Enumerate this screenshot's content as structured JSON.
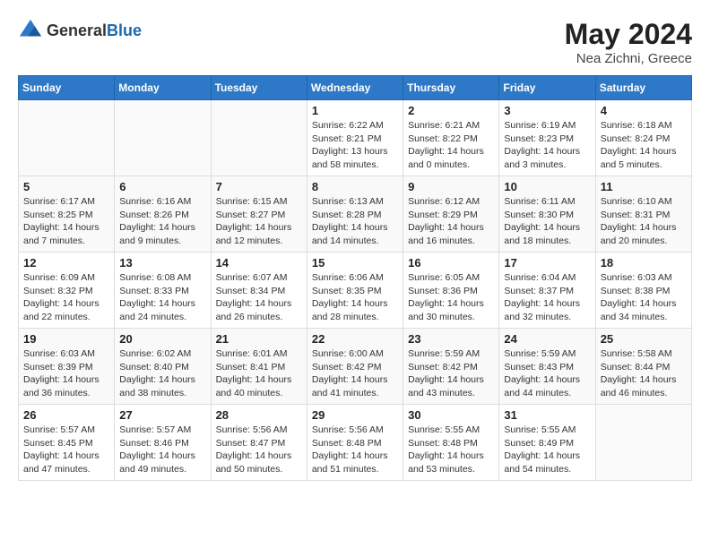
{
  "header": {
    "logo_general": "General",
    "logo_blue": "Blue",
    "month_year": "May 2024",
    "location": "Nea Zichni, Greece"
  },
  "weekdays": [
    "Sunday",
    "Monday",
    "Tuesday",
    "Wednesday",
    "Thursday",
    "Friday",
    "Saturday"
  ],
  "weeks": [
    [
      {
        "day": "",
        "sunrise": "",
        "sunset": "",
        "daylight": ""
      },
      {
        "day": "",
        "sunrise": "",
        "sunset": "",
        "daylight": ""
      },
      {
        "day": "",
        "sunrise": "",
        "sunset": "",
        "daylight": ""
      },
      {
        "day": "1",
        "sunrise": "Sunrise: 6:22 AM",
        "sunset": "Sunset: 8:21 PM",
        "daylight": "Daylight: 13 hours and 58 minutes."
      },
      {
        "day": "2",
        "sunrise": "Sunrise: 6:21 AM",
        "sunset": "Sunset: 8:22 PM",
        "daylight": "Daylight: 14 hours and 0 minutes."
      },
      {
        "day": "3",
        "sunrise": "Sunrise: 6:19 AM",
        "sunset": "Sunset: 8:23 PM",
        "daylight": "Daylight: 14 hours and 3 minutes."
      },
      {
        "day": "4",
        "sunrise": "Sunrise: 6:18 AM",
        "sunset": "Sunset: 8:24 PM",
        "daylight": "Daylight: 14 hours and 5 minutes."
      }
    ],
    [
      {
        "day": "5",
        "sunrise": "Sunrise: 6:17 AM",
        "sunset": "Sunset: 8:25 PM",
        "daylight": "Daylight: 14 hours and 7 minutes."
      },
      {
        "day": "6",
        "sunrise": "Sunrise: 6:16 AM",
        "sunset": "Sunset: 8:26 PM",
        "daylight": "Daylight: 14 hours and 9 minutes."
      },
      {
        "day": "7",
        "sunrise": "Sunrise: 6:15 AM",
        "sunset": "Sunset: 8:27 PM",
        "daylight": "Daylight: 14 hours and 12 minutes."
      },
      {
        "day": "8",
        "sunrise": "Sunrise: 6:13 AM",
        "sunset": "Sunset: 8:28 PM",
        "daylight": "Daylight: 14 hours and 14 minutes."
      },
      {
        "day": "9",
        "sunrise": "Sunrise: 6:12 AM",
        "sunset": "Sunset: 8:29 PM",
        "daylight": "Daylight: 14 hours and 16 minutes."
      },
      {
        "day": "10",
        "sunrise": "Sunrise: 6:11 AM",
        "sunset": "Sunset: 8:30 PM",
        "daylight": "Daylight: 14 hours and 18 minutes."
      },
      {
        "day": "11",
        "sunrise": "Sunrise: 6:10 AM",
        "sunset": "Sunset: 8:31 PM",
        "daylight": "Daylight: 14 hours and 20 minutes."
      }
    ],
    [
      {
        "day": "12",
        "sunrise": "Sunrise: 6:09 AM",
        "sunset": "Sunset: 8:32 PM",
        "daylight": "Daylight: 14 hours and 22 minutes."
      },
      {
        "day": "13",
        "sunrise": "Sunrise: 6:08 AM",
        "sunset": "Sunset: 8:33 PM",
        "daylight": "Daylight: 14 hours and 24 minutes."
      },
      {
        "day": "14",
        "sunrise": "Sunrise: 6:07 AM",
        "sunset": "Sunset: 8:34 PM",
        "daylight": "Daylight: 14 hours and 26 minutes."
      },
      {
        "day": "15",
        "sunrise": "Sunrise: 6:06 AM",
        "sunset": "Sunset: 8:35 PM",
        "daylight": "Daylight: 14 hours and 28 minutes."
      },
      {
        "day": "16",
        "sunrise": "Sunrise: 6:05 AM",
        "sunset": "Sunset: 8:36 PM",
        "daylight": "Daylight: 14 hours and 30 minutes."
      },
      {
        "day": "17",
        "sunrise": "Sunrise: 6:04 AM",
        "sunset": "Sunset: 8:37 PM",
        "daylight": "Daylight: 14 hours and 32 minutes."
      },
      {
        "day": "18",
        "sunrise": "Sunrise: 6:03 AM",
        "sunset": "Sunset: 8:38 PM",
        "daylight": "Daylight: 14 hours and 34 minutes."
      }
    ],
    [
      {
        "day": "19",
        "sunrise": "Sunrise: 6:03 AM",
        "sunset": "Sunset: 8:39 PM",
        "daylight": "Daylight: 14 hours and 36 minutes."
      },
      {
        "day": "20",
        "sunrise": "Sunrise: 6:02 AM",
        "sunset": "Sunset: 8:40 PM",
        "daylight": "Daylight: 14 hours and 38 minutes."
      },
      {
        "day": "21",
        "sunrise": "Sunrise: 6:01 AM",
        "sunset": "Sunset: 8:41 PM",
        "daylight": "Daylight: 14 hours and 40 minutes."
      },
      {
        "day": "22",
        "sunrise": "Sunrise: 6:00 AM",
        "sunset": "Sunset: 8:42 PM",
        "daylight": "Daylight: 14 hours and 41 minutes."
      },
      {
        "day": "23",
        "sunrise": "Sunrise: 5:59 AM",
        "sunset": "Sunset: 8:42 PM",
        "daylight": "Daylight: 14 hours and 43 minutes."
      },
      {
        "day": "24",
        "sunrise": "Sunrise: 5:59 AM",
        "sunset": "Sunset: 8:43 PM",
        "daylight": "Daylight: 14 hours and 44 minutes."
      },
      {
        "day": "25",
        "sunrise": "Sunrise: 5:58 AM",
        "sunset": "Sunset: 8:44 PM",
        "daylight": "Daylight: 14 hours and 46 minutes."
      }
    ],
    [
      {
        "day": "26",
        "sunrise": "Sunrise: 5:57 AM",
        "sunset": "Sunset: 8:45 PM",
        "daylight": "Daylight: 14 hours and 47 minutes."
      },
      {
        "day": "27",
        "sunrise": "Sunrise: 5:57 AM",
        "sunset": "Sunset: 8:46 PM",
        "daylight": "Daylight: 14 hours and 49 minutes."
      },
      {
        "day": "28",
        "sunrise": "Sunrise: 5:56 AM",
        "sunset": "Sunset: 8:47 PM",
        "daylight": "Daylight: 14 hours and 50 minutes."
      },
      {
        "day": "29",
        "sunrise": "Sunrise: 5:56 AM",
        "sunset": "Sunset: 8:48 PM",
        "daylight": "Daylight: 14 hours and 51 minutes."
      },
      {
        "day": "30",
        "sunrise": "Sunrise: 5:55 AM",
        "sunset": "Sunset: 8:48 PM",
        "daylight": "Daylight: 14 hours and 53 minutes."
      },
      {
        "day": "31",
        "sunrise": "Sunrise: 5:55 AM",
        "sunset": "Sunset: 8:49 PM",
        "daylight": "Daylight: 14 hours and 54 minutes."
      },
      {
        "day": "",
        "sunrise": "",
        "sunset": "",
        "daylight": ""
      }
    ]
  ]
}
